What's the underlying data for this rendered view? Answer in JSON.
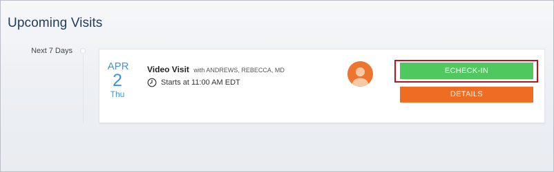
{
  "section": {
    "title": "Upcoming Visits"
  },
  "timeline": {
    "group_label": "Next 7 Days"
  },
  "visit": {
    "date": {
      "month": "APR",
      "day": "2",
      "weekday": "Thu"
    },
    "type": "Video Visit",
    "with_text": "with ANDREWS, REBECCA, MD",
    "time_text": "Starts at 11:00 AM EDT",
    "avatar_icon": "provider-avatar-icon",
    "clock_icon": "clock-icon"
  },
  "actions": {
    "echeckin_label": "ECHECK-IN",
    "details_label": "DETAILS"
  },
  "colors": {
    "title": "#1f3b5a",
    "date_accent": "#3b95dc",
    "echeckin": "#4fc95f",
    "details": "#ef6c23",
    "avatar_bg": "#ee7530",
    "highlight_border": "#b3161c"
  }
}
